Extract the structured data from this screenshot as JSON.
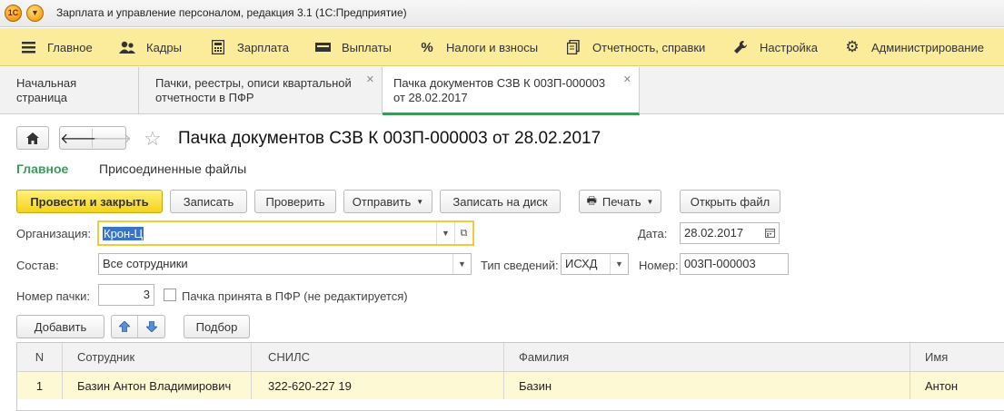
{
  "window": {
    "title": "Зарплата и управление персоналом, редакция 3.1  (1С:Предприятие)",
    "logo_text": "1С"
  },
  "sections": [
    {
      "label": "Главное",
      "icon": "menu-icon"
    },
    {
      "label": "Кадры",
      "icon": "people-icon"
    },
    {
      "label": "Зарплата",
      "icon": "calculator-icon"
    },
    {
      "label": "Выплаты",
      "icon": "wallet-icon"
    },
    {
      "label": "Налоги и взносы",
      "icon": "percent-icon"
    },
    {
      "label": "Отчетность, справки",
      "icon": "reports-icon"
    },
    {
      "label": "Настройка",
      "icon": "wrench-icon"
    },
    {
      "label": "Администрирование",
      "icon": "gear-icon"
    }
  ],
  "tabs": [
    {
      "label": "Начальная страница"
    },
    {
      "label": "Пачки, реестры, описи квартальной отчетности в ПФР"
    },
    {
      "label": "Пачка документов СЗВ К 003П-000003 от 28.02.2017"
    }
  ],
  "form": {
    "title": "Пачка документов СЗВ К 003П-000003 от 28.02.2017",
    "tab_main": "Главное",
    "tab_files": "Присоединенные файлы",
    "buttons": {
      "post_close": "Провести и закрыть",
      "write": "Записать",
      "check": "Проверить",
      "send": "Отправить",
      "write_disk": "Записать на диск",
      "print": "Печать",
      "open_file": "Открыть файл"
    },
    "organization_label": "Организация:",
    "organization_value": "Крон-Ц",
    "date_label": "Дата:",
    "date_value": "28.02.2017",
    "composition_label": "Состав:",
    "composition_value": "Все сотрудники",
    "info_type_label": "Тип сведений:",
    "info_type_value": "ИСХД",
    "number_label": "Номер:",
    "number_value": "003П-000003",
    "pack_number_label": "Номер пачки:",
    "pack_number_value": "3",
    "accepted_label": "Пачка принята в ПФР (не редактируется)",
    "add_button": "Добавить",
    "select_button": "Подбор"
  },
  "table": {
    "columns": [
      "N",
      "Сотрудник",
      "СНИЛС",
      "Фамилия",
      "Имя"
    ],
    "rows": [
      [
        "1",
        "Базин Антон Владимирович",
        "322-620-227 19",
        "Базин",
        "Антон"
      ]
    ]
  },
  "colors": {
    "section_bar": "#fbec9b",
    "primary_button": "#f4d319",
    "active_tab_line": "#3a9a5a",
    "selected_row": "#fdf9d5"
  }
}
